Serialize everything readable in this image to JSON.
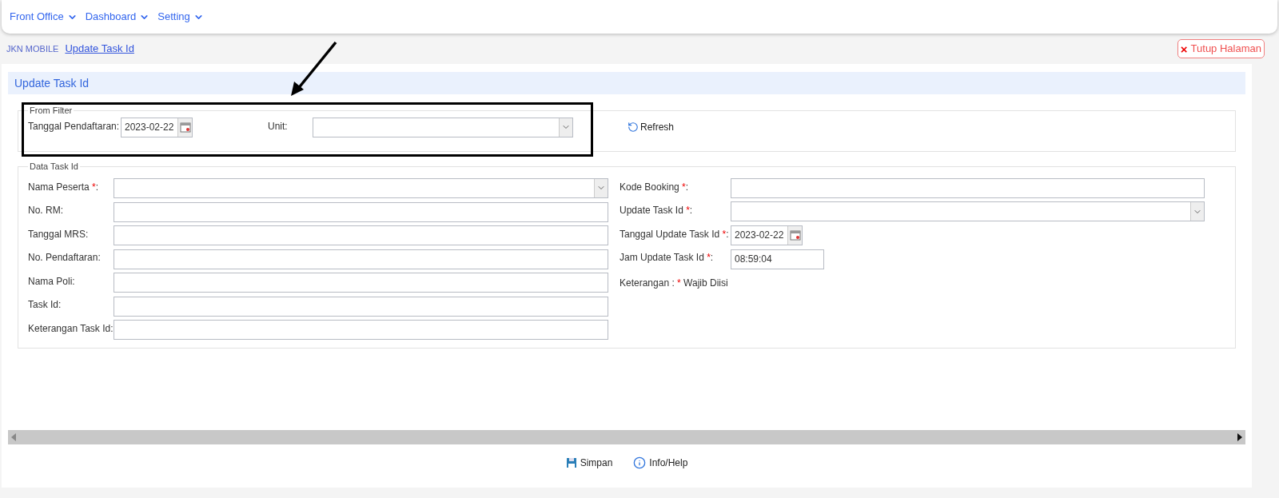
{
  "menu": [
    {
      "label": "Front Office"
    },
    {
      "label": "Dashboard"
    },
    {
      "label": "Setting"
    }
  ],
  "breadcrumb": [
    {
      "label": "JKN MOBILE",
      "selected": false
    },
    {
      "label": "Update Task Id",
      "selected": true
    }
  ],
  "close_button": {
    "icon": "×",
    "label": "Tutup Halaman"
  },
  "panel_title": "Update Task Id",
  "filter": {
    "legend": "From Filter",
    "fields": [
      {
        "label": "Tanggal Pendaftaran:",
        "kind": "date",
        "value": "2023-02-22"
      },
      {
        "label": "Unit:",
        "kind": "select"
      }
    ],
    "refresh": "Refresh"
  },
  "data": {
    "legend": "Data Task Id",
    "left": [
      {
        "label": "Nama Peserta",
        "mark": "*",
        "suffix": ":",
        "kind": "select"
      },
      {
        "label": "No. RM:",
        "kind": "text"
      },
      {
        "label": "Tanggal MRS:",
        "kind": "text"
      },
      {
        "label": "No. Pendaftaran:",
        "kind": "text"
      },
      {
        "label": "Nama Poli:",
        "kind": "text"
      },
      {
        "label": "Task Id:",
        "kind": "text"
      },
      {
        "label": "Keterangan Task Id:",
        "kind": "text"
      }
    ],
    "right": [
      {
        "label": "Kode Booking",
        "mark": "*",
        "suffix": ":",
        "kind": "text"
      },
      {
        "label": "Update Task Id",
        "mark": "*",
        "suffix": ":",
        "kind": "select"
      },
      {
        "label": "Tanggal Update Task Id",
        "mark": "*",
        "suffix": ":",
        "kind": "date",
        "value": "2023-02-22"
      },
      {
        "label": "Jam Update Task Id",
        "mark": "*",
        "suffix": ":",
        "kind": "time",
        "value": "08:59:04"
      }
    ],
    "note": {
      "label": "Keterangan :",
      "mark": "*",
      "text": "Wajib Diisi"
    }
  },
  "footer": [
    {
      "label": "Simpan",
      "kind": "save"
    },
    {
      "label": "Info/Help",
      "kind": "info"
    }
  ]
}
